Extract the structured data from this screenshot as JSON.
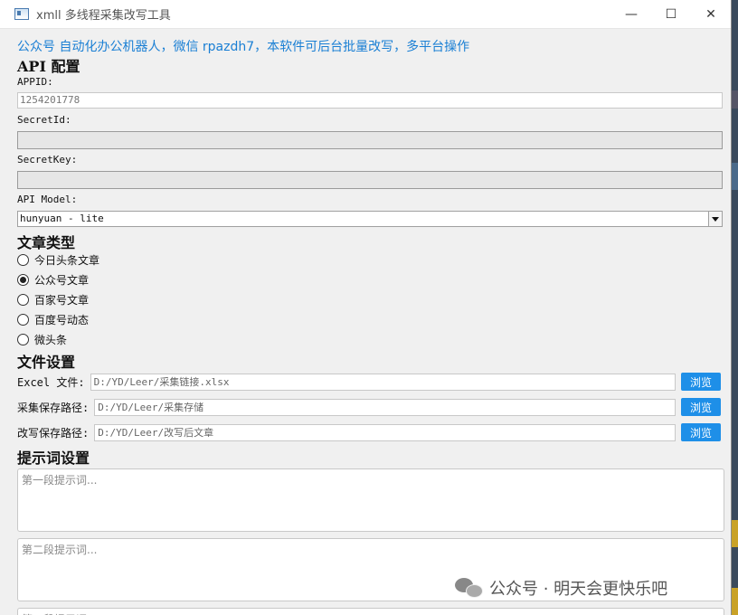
{
  "window": {
    "title": "xmll 多线程采集改写工具",
    "minimize": "—",
    "maximize": "☐",
    "close": "✕"
  },
  "promo": "公众号 自动化办公机器人，微信 rpazdh7，本软件可后台批量改写，多平台操作",
  "api": {
    "heading": "API 配置",
    "appid_label": "APPID:",
    "appid_value": "1254201778",
    "secretid_label": "SecretId:",
    "secretid_value": "",
    "secretkey_label": "SecretKey:",
    "secretkey_value": "",
    "model_label": "API Model:",
    "model_value": "hunyuan - lite"
  },
  "article_type": {
    "heading": "文章类型",
    "options": [
      {
        "label": "今日头条文章",
        "checked": false
      },
      {
        "label": "公众号文章",
        "checked": true
      },
      {
        "label": "百家号文章",
        "checked": false
      },
      {
        "label": "百度号动态",
        "checked": false
      },
      {
        "label": "微头条",
        "checked": false
      }
    ]
  },
  "file_settings": {
    "heading": "文件设置",
    "rows": [
      {
        "label": "Excel 文件:",
        "value": "D:/YD/Leer/采集链接.xlsx",
        "button": "浏览"
      },
      {
        "label": "采集保存路径:",
        "value": "D:/YD/Leer/采集存储",
        "button": "浏览"
      },
      {
        "label": "改写保存路径:",
        "value": "D:/YD/Leer/改写后文章",
        "button": "浏览"
      }
    ]
  },
  "prompts": {
    "heading": "提示词设置",
    "p1_placeholder": "第一段提示词...",
    "p2_placeholder": "第二段提示词...",
    "p3_placeholder": "第三段提示词..."
  },
  "watermark": {
    "text": "公众号 · 明天会更快乐吧",
    "icon": "wechat-icon"
  },
  "colors": {
    "promo": "#1a7fd4",
    "button": "#1e8fe8"
  }
}
